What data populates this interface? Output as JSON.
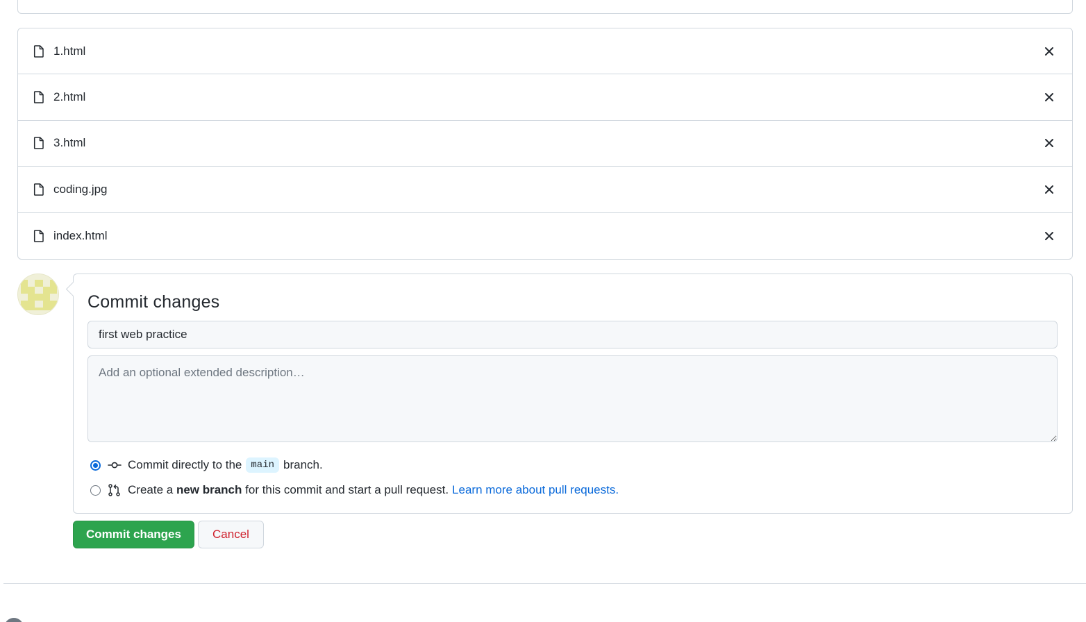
{
  "files": [
    {
      "name": "1.html",
      "icon": "file-icon"
    },
    {
      "name": "2.html",
      "icon": "file-icon"
    },
    {
      "name": "3.html",
      "icon": "file-icon"
    },
    {
      "name": "coding.jpg",
      "icon": "file-icon"
    },
    {
      "name": "index.html",
      "icon": "file-icon"
    }
  ],
  "commit": {
    "title": "Commit changes",
    "summary_value": "first web practice",
    "description_placeholder": "Add an optional extended description…",
    "option_direct": {
      "prefix": "Commit directly to the",
      "branch": "main",
      "suffix": "branch.",
      "checked": true
    },
    "option_new_branch": {
      "prefix": "Create a",
      "bold": "new branch",
      "suffix": "for this commit and start a pull request.",
      "link": "Learn more about pull requests.",
      "checked": false
    }
  },
  "buttons": {
    "commit_label": "Commit changes",
    "cancel_label": "Cancel"
  },
  "colors": {
    "primary_green": "#2da44e",
    "danger_red": "#cf222e",
    "link_blue": "#0969da",
    "border": "#d0d7de"
  }
}
